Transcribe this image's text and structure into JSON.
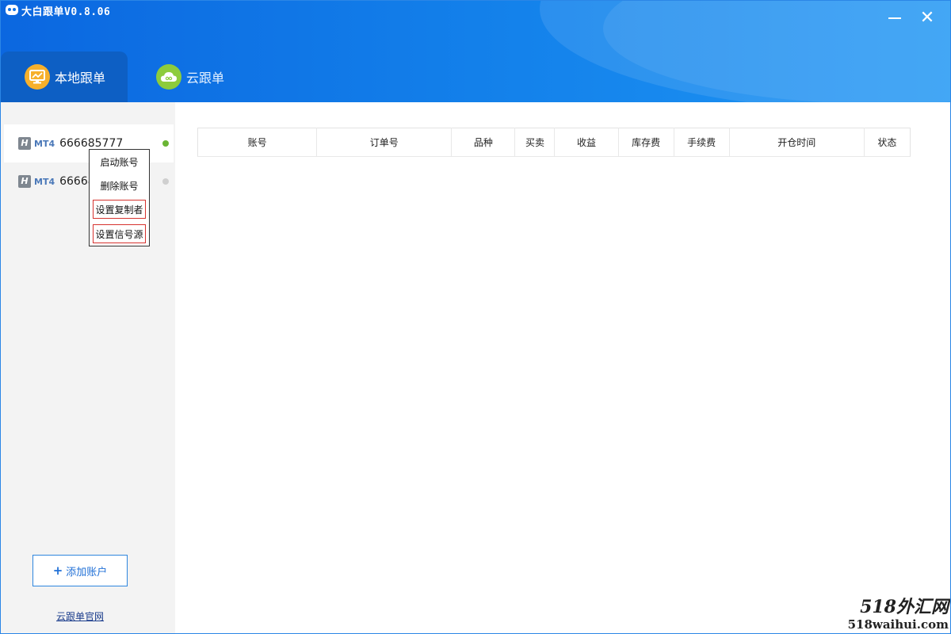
{
  "window": {
    "title": "大白跟单V0.8.06",
    "minimize_icon": "minimize-icon",
    "close_icon": "close-icon",
    "close_glyph": "✕"
  },
  "tabs": [
    {
      "label": "本地跟单",
      "icon": "monitor-chart-icon",
      "active": true,
      "icon_color": "#f6b02b"
    },
    {
      "label": "云跟单",
      "icon": "cloud-icon",
      "active": false,
      "icon_color": "#8dcc3c"
    }
  ],
  "sidebar": {
    "accounts": [
      {
        "platform_badge": "H",
        "platform": "MT4",
        "number": "666685777",
        "status": "online",
        "status_color": "#6ab534",
        "active": true
      },
      {
        "platform_badge": "H",
        "platform": "MT4",
        "number": "66668",
        "status": "offline",
        "status_color": "#cfcfcf",
        "active": false
      }
    ],
    "add_account": {
      "plus": "+",
      "label": "添加账户"
    },
    "website_link": "云跟单官网"
  },
  "context_menu": {
    "items": [
      {
        "label": "启动账号",
        "highlighted": false
      },
      {
        "label": "删除账号",
        "highlighted": false
      },
      {
        "label": "设置复制者",
        "highlighted": true
      },
      {
        "label": "设置信号源",
        "highlighted": true
      }
    ]
  },
  "orders_table": {
    "columns": [
      "账号",
      "订单号",
      "品种",
      "买卖",
      "收益",
      "库存费",
      "手续费",
      "开仓时间",
      "状态"
    ],
    "rows": []
  },
  "watermark": {
    "top": "518外汇网",
    "bottom": "518waihui.com"
  },
  "colors": {
    "header_blue": "#1380ea",
    "active_tab": "#0d5fc4",
    "accent_link": "#1f6fd6",
    "highlight_border": "#d6332f"
  }
}
